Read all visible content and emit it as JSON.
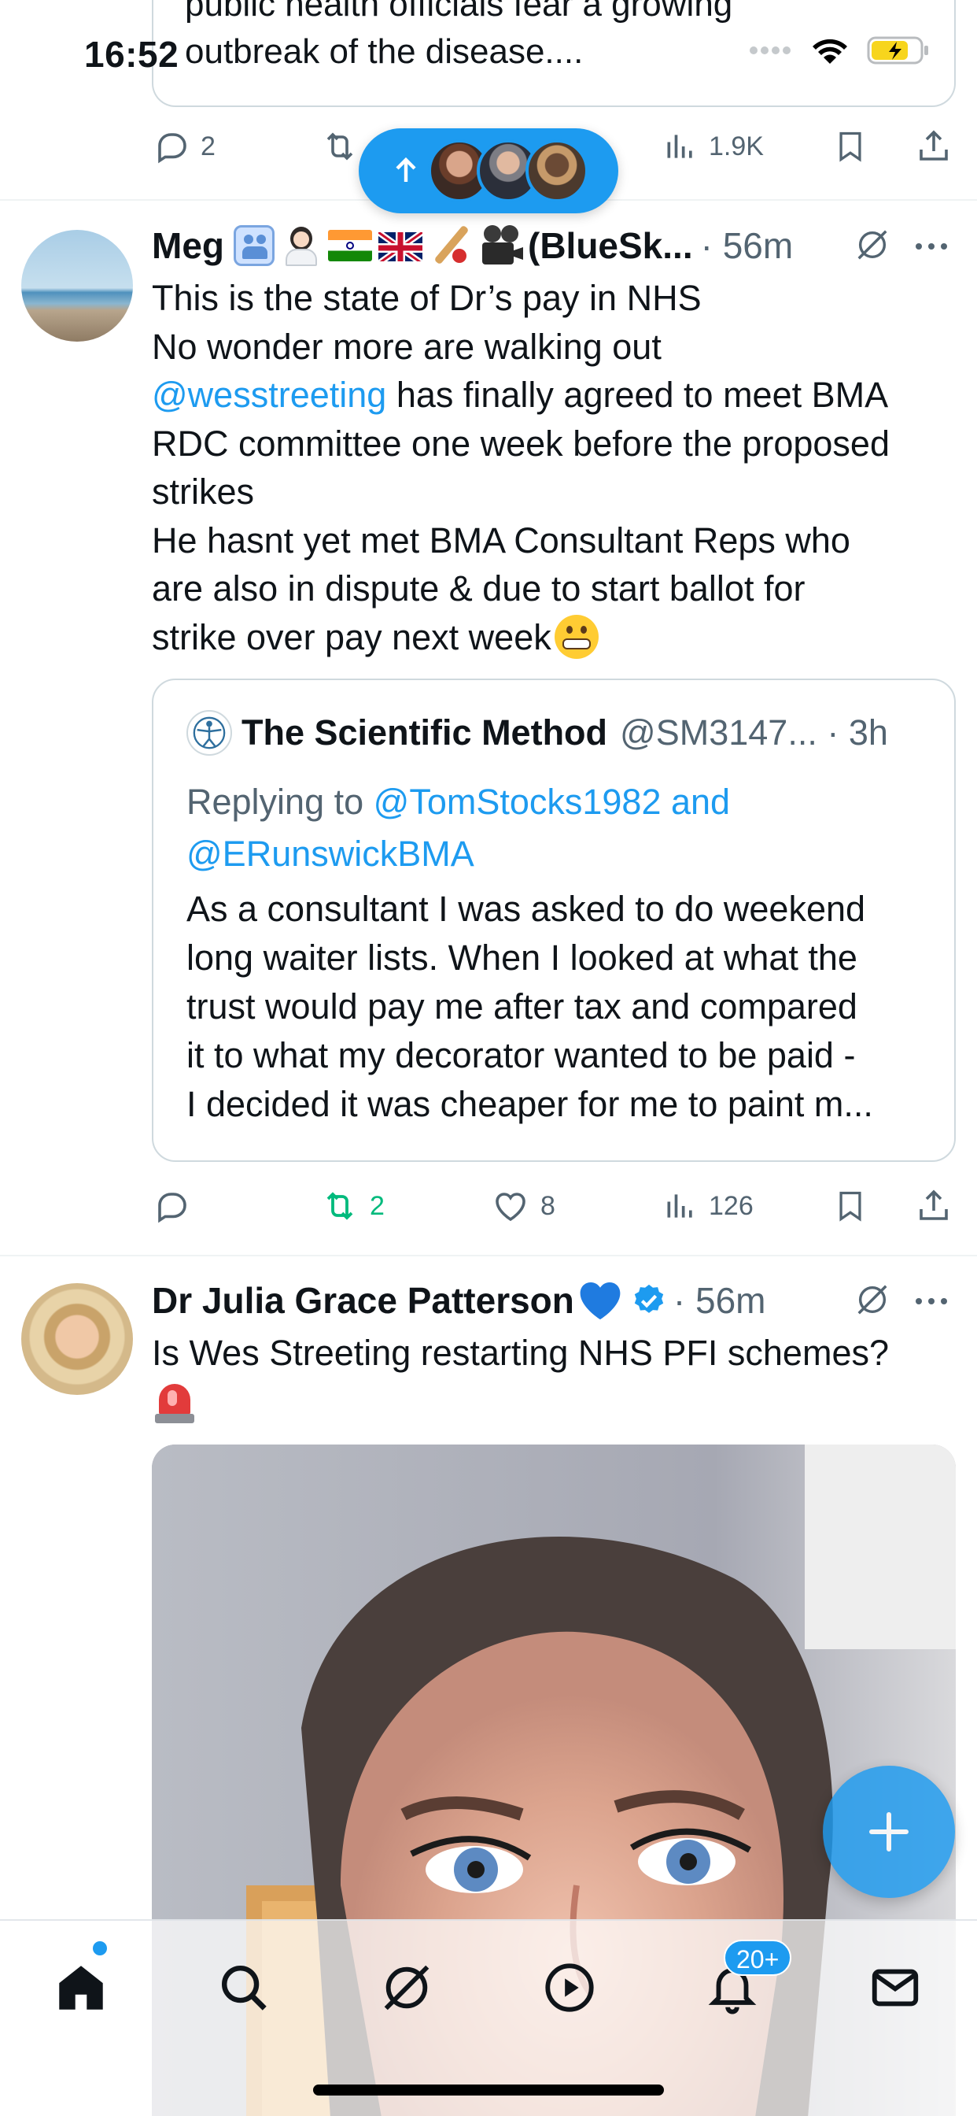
{
  "status_bar": {
    "time": "16:52"
  },
  "top_tweet": {
    "card_text_line1": "public health officials fear a growing",
    "card_text_line2": "outbreak of the disease....",
    "replies": "2",
    "views": "1.9K"
  },
  "new_posts_pill": {
    "icon": "arrow-up-icon"
  },
  "tweet1": {
    "author_name": "Meg",
    "emojis": [
      "family-icon",
      "woman-doctor-icon",
      "india-flag-icon",
      "uk-flag-icon",
      "cricket-icon",
      "movie-camera-icon"
    ],
    "name_suffix": "(BlueSk...",
    "time": "· 56m",
    "text_line1": "This is the state of Dr’s pay in NHS",
    "text_line2": "No wonder more are walking out",
    "mention": "@wesstreeting",
    "text_line3_rest": " has finally agreed to meet BMA",
    "text_line4": "RDC committee one week before the proposed",
    "text_line5": "strikes",
    "text_line6": "He hasnt yet met BMA Consultant Reps who",
    "text_line7": "are also in dispute & due to start ballot for",
    "text_line8": "strike over pay next week",
    "quote": {
      "name": "The Scientific Method",
      "handle_time": "@SM3147... · 3h",
      "replying_prefix": "Replying to ",
      "replying_to_1": "@TomStocks1982 and",
      "replying_to_2": "@ERunswickBMA",
      "text_line1": "As a consultant I was asked to do weekend",
      "text_line2": "long waiter lists. When I looked at what the",
      "text_line3": "trust would pay me after tax and compared",
      "text_line4": "it to what my decorator wanted to be paid -",
      "text_line5": "I decided it was cheaper for me to paint m..."
    },
    "retweets": "2",
    "likes": "8",
    "views": "126"
  },
  "tweet2": {
    "author_name": "Dr Julia Grace Patterson",
    "time": "· 56m",
    "text": "Is Wes Streeting restarting NHS PFI schemes?",
    "emoji": "police-light-icon"
  },
  "tab_bar": {
    "items": [
      "home-icon",
      "search-icon",
      "grok-icon",
      "play-icon",
      "bell-icon",
      "mail-icon"
    ],
    "notifications_badge": "20+"
  },
  "colors": {
    "accent": "#1d9bf0",
    "retweet_active": "#00ba7c",
    "text": "#0f1419",
    "muted": "#536471"
  }
}
